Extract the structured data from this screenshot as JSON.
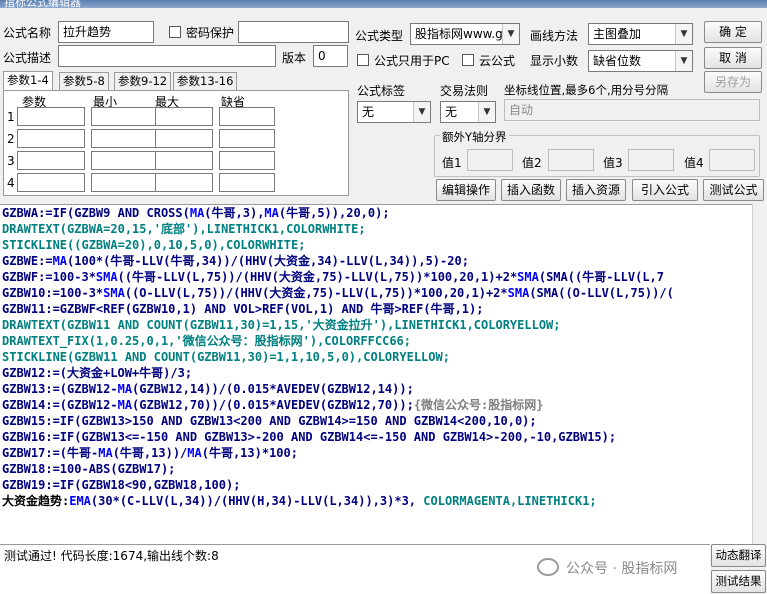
{
  "window": {
    "title": "指标公式编辑器"
  },
  "form": {
    "name_label": "公式名称",
    "name_value": "拉升趋势",
    "pwd_label": "密码保护",
    "type_label": "公式类型",
    "type_value": "股指标网www.g",
    "draw_label": "画线方法",
    "draw_value": "主图叠加",
    "desc_label": "公式描述",
    "desc_value": "",
    "version_label": "版本",
    "version_value": "0",
    "pc_label": "公式只用于PC",
    "cloud_label": "云公式",
    "decimals_label": "显示小数",
    "decimals_value": "缺省位数"
  },
  "buttons": {
    "ok": "确 定",
    "cancel": "取 消",
    "saveas": "另存为",
    "edit_op": "编辑操作",
    "insert_func": "插入函数",
    "insert_res": "插入资源",
    "import": "引入公式",
    "test": "测试公式",
    "translate": "动态翻译",
    "test_result": "测试结果"
  },
  "params": {
    "tabs": [
      "参数1-4",
      "参数5-8",
      "参数9-12",
      "参数13-16"
    ],
    "headers": [
      "参数",
      "最小",
      "最大",
      "缺省"
    ],
    "rows": [
      "1",
      "2",
      "3",
      "4"
    ]
  },
  "tags": {
    "tag_label": "公式标签",
    "tag_value": "无",
    "trade_label": "交易法则",
    "trade_value": "无",
    "coord_label": "坐标线位置,最多6个,用分号分隔",
    "coord_value": "自动"
  },
  "yaxis": {
    "title": "额外Y轴分界",
    "labels": [
      "值1",
      "值2",
      "值3",
      "值4"
    ]
  },
  "code": [
    [
      [
        "GZBWA:=IF(GZBW9 AND CROSS(",
        "#000080"
      ],
      [
        "MA",
        "#0000ff"
      ],
      [
        "(牛哥,3),",
        "#000080"
      ],
      [
        "MA",
        "#0000ff"
      ],
      [
        "(牛哥,5)),20,0);",
        "#000080"
      ]
    ],
    [
      [
        "DRAWTEXT",
        "#008080"
      ],
      [
        "(GZBWA=20,15,'底部'),LINETHICK1,COLORWHITE;",
        "#008080"
      ]
    ],
    [
      [
        "STICKLINE",
        "#008080"
      ],
      [
        "((GZBWA=20),0,10,5,0),COLORWHITE;",
        "#008080"
      ]
    ],
    [
      [
        "GZBWE:=",
        "#000080"
      ],
      [
        "MA",
        "#0000ff"
      ],
      [
        "(100*(牛哥-LLV(牛哥,34))/(HHV(大资金,34)-LLV(L,34)),5)-20;",
        "#000080"
      ]
    ],
    [
      [
        "GZBWF:=100-3*",
        "#000080"
      ],
      [
        "SMA",
        "#0000ff"
      ],
      [
        "((牛哥-LLV(L,75))/(HHV(大资金,75)-LLV(L,75))*100,20,1)+2*",
        "#000080"
      ],
      [
        "SMA",
        "#0000ff"
      ],
      [
        "(SMA((牛哥-LLV(L,7",
        "#000080"
      ]
    ],
    [
      [
        "GZBW10:=100-3*",
        "#000080"
      ],
      [
        "SMA",
        "#0000ff"
      ],
      [
        "((O-LLV(L,75))/(HHV(大资金,75)-LLV(L,75))*100,20,1)+2*",
        "#000080"
      ],
      [
        "SMA",
        "#0000ff"
      ],
      [
        "(SMA((O-LLV(L,75))/(",
        "#000080"
      ]
    ],
    [
      [
        "GZBW11:=GZBWF<REF(GZBW10,1) AND VOL>REF(VOL,1) AND 牛哥>REF(牛哥,1);",
        "#000080"
      ]
    ],
    [
      [
        "DRAWTEXT",
        "#008080"
      ],
      [
        "(GZBW11 AND COUNT(GZBW11,30)=1,15,'大资金拉升'),LINETHICK1,COLORYELLOW;",
        "#008080"
      ]
    ],
    [
      [
        "DRAWTEXT_FIX",
        "#008080"
      ],
      [
        "(1,0.25,0,1,'微信公众号：股指标网'),COLORFFCC66;",
        "#008080"
      ]
    ],
    [
      [
        "STICKLINE",
        "#008080"
      ],
      [
        "(GZBW11 AND COUNT(GZBW11,30)=1,1,10,5,0),COLORYELLOW;",
        "#008080"
      ]
    ],
    [
      [
        "GZBW12:=(大资金+LOW+牛哥)/3;",
        "#000080"
      ]
    ],
    [
      [
        "GZBW13:=(GZBW12-",
        "#000080"
      ],
      [
        "MA",
        "#0000ff"
      ],
      [
        "(GZBW12,14))/(0.015*AVEDEV(GZBW12,14));",
        "#000080"
      ]
    ],
    [
      [
        "GZBW14:=(GZBW12-",
        "#000080"
      ],
      [
        "MA",
        "#0000ff"
      ],
      [
        "(GZBW12,70))/(0.015*AVEDEV(GZBW12,70));",
        "#000080"
      ],
      [
        "{微信公众号:股指标网}",
        "#808080"
      ]
    ],
    [
      [
        "GZBW15:=IF(GZBW13>150 AND GZBW13<200 AND GZBW14>=150 AND GZBW14<200,10,0);",
        "#000080"
      ]
    ],
    [
      [
        "GZBW16:=IF(GZBW13<=-150 AND GZBW13>-200 AND GZBW14<=-150 AND GZBW14>-200,-10,GZBW15);",
        "#000080"
      ]
    ],
    [
      [
        "GZBW17:=(牛哥-",
        "#000080"
      ],
      [
        "MA",
        "#0000ff"
      ],
      [
        "(牛哥,13))/",
        "#000080"
      ],
      [
        "MA",
        "#0000ff"
      ],
      [
        "(牛哥,13)*100;",
        "#000080"
      ]
    ],
    [
      [
        "GZBW18:=100-ABS(GZBW17);",
        "#000080"
      ]
    ],
    [
      [
        "GZBW19:=IF(GZBW18<90,GZBW18,100);",
        "#000080"
      ]
    ],
    [
      [
        "大资金趋势:",
        "#000000"
      ],
      [
        "EMA",
        "#0000ff"
      ],
      [
        "(30*(C-LLV(L,34))/(HHV(H,34)-LLV(L,34)),3)*3, ",
        "#000080"
      ],
      [
        "COLORMAGENTA,LINETHICK1;",
        "#008080"
      ]
    ]
  ],
  "status": {
    "text": "测试通过! 代码长度:1674,输出线个数:8",
    "watermark": "公众号 · 股指标网"
  }
}
